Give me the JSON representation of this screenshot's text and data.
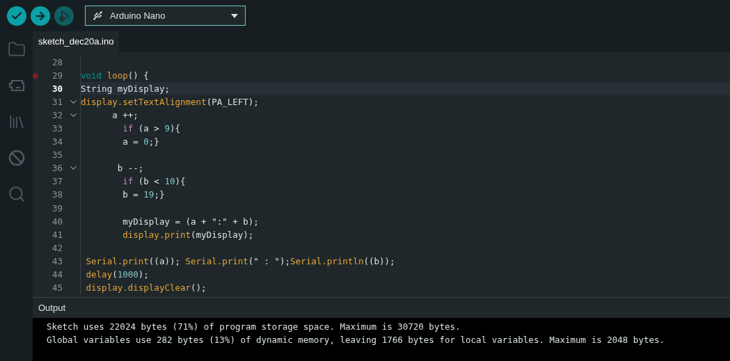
{
  "toolbar": {
    "buttons": [
      {
        "kind": "verify",
        "disabled": false
      },
      {
        "kind": "upload",
        "disabled": false
      },
      {
        "kind": "debug",
        "disabled": true
      }
    ],
    "board_selector": {
      "label": "Arduino Nano"
    }
  },
  "sidebar": {
    "items": [
      {
        "kind": "folder",
        "selected": false
      },
      {
        "kind": "board",
        "selected": false
      },
      {
        "kind": "library",
        "selected": false
      },
      {
        "kind": "debug",
        "selected": false
      },
      {
        "kind": "search",
        "selected": false
      }
    ]
  },
  "tabs": [
    {
      "label": "sketch_dec20a.ino",
      "selected": true
    }
  ],
  "editor": {
    "lines": [
      {
        "number": "28",
        "fold": false,
        "breakpoint": false,
        "current": false
      },
      {
        "number": "29",
        "tokens": [
          {
            "text": "void",
            "kind": "keyword"
          },
          {
            "text": " loop",
            "kind": "function"
          },
          {
            "text": "() {",
            "kind": "plain"
          }
        ],
        "fold": false,
        "breakpoint": true,
        "current": false
      },
      {
        "number": "30",
        "tokens": [
          {
            "text": "String myDisplay;",
            "kind": "plain"
          }
        ],
        "fold": false,
        "breakpoint": false,
        "current": true
      },
      {
        "number": "31",
        "tokens": [
          {
            "text": "display.setTextAlignment",
            "kind": "function"
          },
          {
            "text": "(PA_LEFT);",
            "kind": "plain"
          }
        ],
        "fold": true,
        "breakpoint": false,
        "current": false
      },
      {
        "number": "32",
        "tokens": [
          {
            "text": "      a ++;",
            "kind": "plain"
          }
        ],
        "fold": true,
        "breakpoint": false,
        "current": false
      },
      {
        "number": "33",
        "tokens": [
          {
            "text": "        if",
            "kind": "control"
          },
          {
            "text": " (a > ",
            "kind": "plain"
          },
          {
            "text": "9",
            "kind": "number"
          },
          {
            "text": "){",
            "kind": "plain"
          }
        ],
        "fold": false,
        "breakpoint": false,
        "current": false
      },
      {
        "number": "34",
        "tokens": [
          {
            "text": "        a = ",
            "kind": "plain"
          },
          {
            "text": "0",
            "kind": "number"
          },
          {
            "text": ";}",
            "kind": "plain"
          }
        ],
        "fold": false,
        "breakpoint": false,
        "current": false
      },
      {
        "number": "35",
        "fold": false,
        "breakpoint": false,
        "current": false
      },
      {
        "number": "36",
        "tokens": [
          {
            "text": "       b --;",
            "kind": "plain"
          }
        ],
        "fold": true,
        "breakpoint": false,
        "current": false
      },
      {
        "number": "37",
        "tokens": [
          {
            "text": "        if",
            "kind": "control"
          },
          {
            "text": " (b < ",
            "kind": "plain"
          },
          {
            "text": "10",
            "kind": "number"
          },
          {
            "text": "){",
            "kind": "plain"
          }
        ],
        "fold": false,
        "breakpoint": false,
        "current": false
      },
      {
        "number": "38",
        "tokens": [
          {
            "text": "        b = ",
            "kind": "plain"
          },
          {
            "text": "19",
            "kind": "number"
          },
          {
            "text": ";}",
            "kind": "plain"
          }
        ],
        "fold": false,
        "breakpoint": false,
        "current": false
      },
      {
        "number": "39",
        "fold": false,
        "breakpoint": false,
        "current": false
      },
      {
        "number": "40",
        "tokens": [
          {
            "text": "        myDisplay = (a + \":\" + b);",
            "kind": "plain"
          }
        ],
        "fold": false,
        "breakpoint": false,
        "current": false
      },
      {
        "number": "41",
        "tokens": [
          {
            "text": "        display.print",
            "kind": "function"
          },
          {
            "text": "(myDisplay);",
            "kind": "plain"
          }
        ],
        "fold": false,
        "breakpoint": false,
        "current": false
      },
      {
        "number": "42",
        "fold": false,
        "breakpoint": false,
        "current": false
      },
      {
        "number": "43",
        "tokens": [
          {
            "text": " Serial.print",
            "kind": "function"
          },
          {
            "text": "((a)); ",
            "kind": "plain"
          },
          {
            "text": "Serial.print",
            "kind": "function"
          },
          {
            "text": "(\" : \");",
            "kind": "plain"
          },
          {
            "text": "Serial.println",
            "kind": "function"
          },
          {
            "text": "((b));",
            "kind": "plain"
          }
        ],
        "fold": false,
        "breakpoint": false,
        "current": false
      },
      {
        "number": "44",
        "tokens": [
          {
            "text": " delay",
            "kind": "function"
          },
          {
            "text": "(",
            "kind": "plain"
          },
          {
            "text": "1000",
            "kind": "number"
          },
          {
            "text": ");",
            "kind": "plain"
          }
        ],
        "fold": false,
        "breakpoint": false,
        "current": false
      },
      {
        "number": "45",
        "tokens": [
          {
            "text": " display.displayClear",
            "kind": "function"
          },
          {
            "text": "();",
            "kind": "plain"
          }
        ],
        "fold": false,
        "breakpoint": false,
        "current": false
      }
    ]
  },
  "output": {
    "title": "Output",
    "lines": [
      "Sketch uses 22024 bytes (71%) of program storage space. Maximum is 30720 bytes.",
      "Global variables use 282 bytes (13%) of dynamic memory, leaving 1766 bytes for local variables. Maximum is 2048 bytes."
    ]
  }
}
